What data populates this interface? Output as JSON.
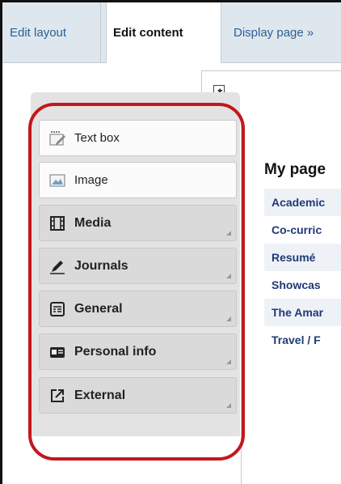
{
  "tabs": {
    "edit_layout": "Edit layout",
    "edit_content": "Edit content",
    "display_page": "Display page »"
  },
  "blocks": [
    {
      "label": "Text box",
      "icon": "text-box-icon",
      "style": "light"
    },
    {
      "label": "Image",
      "icon": "image-icon",
      "style": "light"
    },
    {
      "label": "Media",
      "icon": "film-icon",
      "style": "dark"
    },
    {
      "label": "Journals",
      "icon": "pen-icon",
      "style": "dark"
    },
    {
      "label": "General",
      "icon": "general-list-icon",
      "style": "dark"
    },
    {
      "label": "Personal info",
      "icon": "id-card-icon",
      "style": "dark"
    },
    {
      "label": "External",
      "icon": "external-link-icon",
      "style": "dark"
    }
  ],
  "page": {
    "title": "My page",
    "links": [
      "Academic",
      "Co-curric",
      "Resumé",
      "Showcas",
      "The Amar",
      "Travel / F"
    ]
  },
  "colors": {
    "highlight": "#c4161c",
    "tab_link": "#2b5f95",
    "page_link": "#1f3a76"
  }
}
